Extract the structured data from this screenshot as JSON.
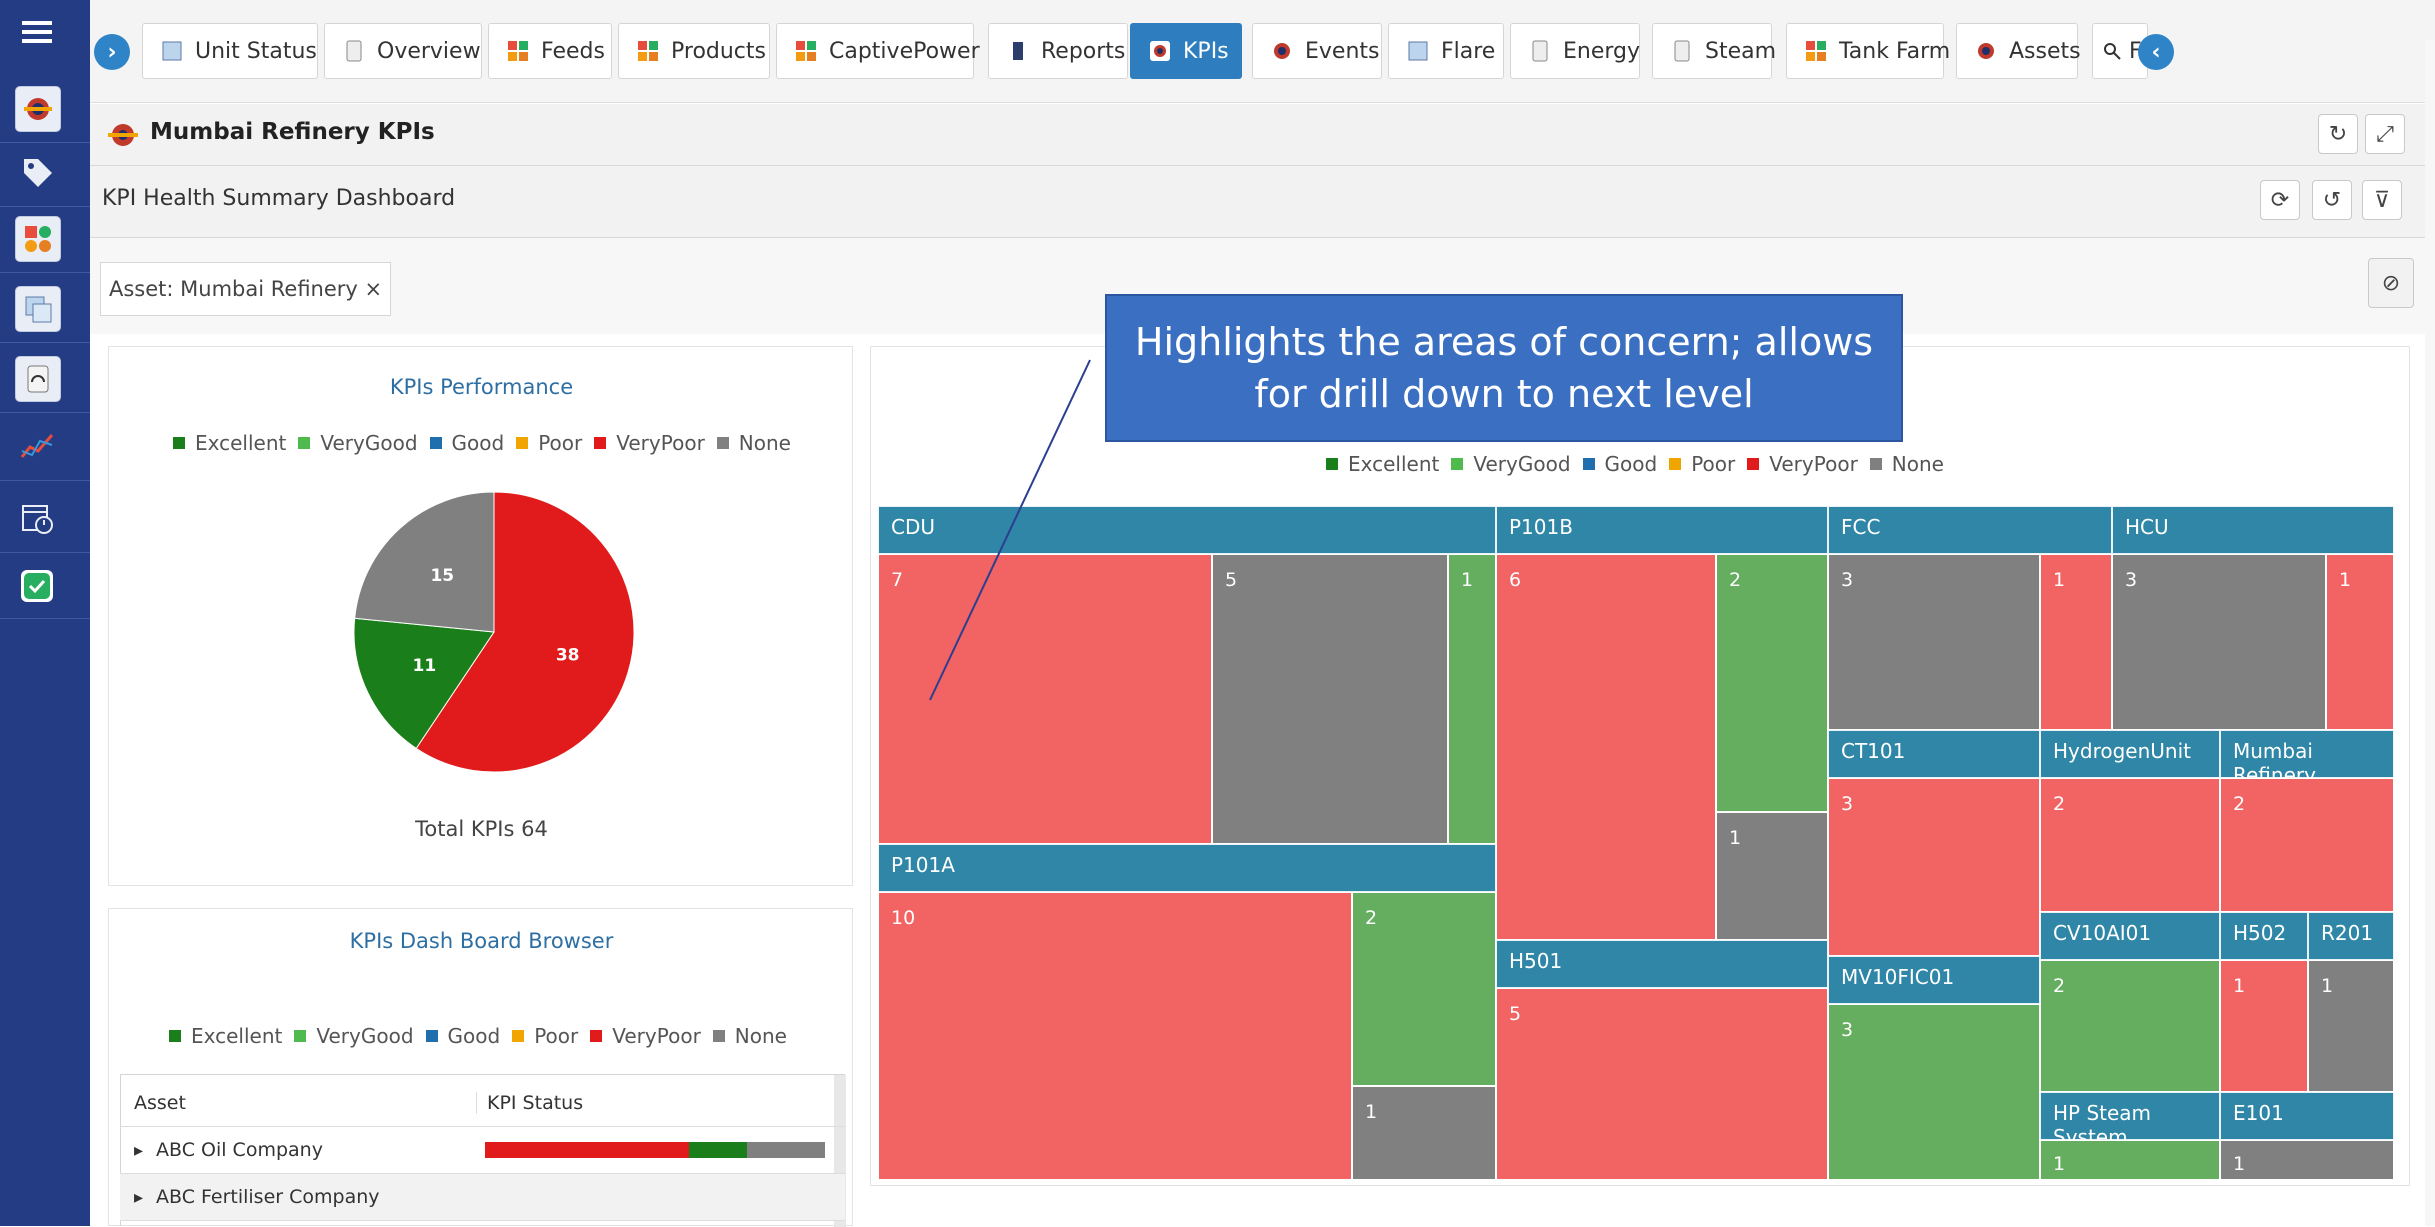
{
  "colors": {
    "rail": "#243c83",
    "accent": "#2e7ebf",
    "excellent": "#1a7f1a",
    "verygood": "#4fbb4f",
    "good": "#1f6fae",
    "poor": "#f0a500",
    "verypoor": "#e11b1b",
    "none": "#808080",
    "tm_red": "#f26363",
    "tm_green": "#65ad5f",
    "tm_gray": "#808080",
    "tm_band": "#2f86a6"
  },
  "rail_icons": [
    "menu-icon",
    "logo-icon",
    "tag-icon",
    "palette-icon",
    "monitor-icon",
    "gauge-icon",
    "trend-icon",
    "calendar-clock-icon",
    "check-icon"
  ],
  "tabs": [
    {
      "label": "Unit Status",
      "icon": "document-icon"
    },
    {
      "label": "Overview",
      "icon": "gauge-icon"
    },
    {
      "label": "Feeds",
      "icon": "grid-icon"
    },
    {
      "label": "Products",
      "icon": "grid-icon"
    },
    {
      "label": "CaptivePower",
      "icon": "grid-icon"
    },
    {
      "label": "Reports",
      "icon": "book-icon"
    },
    {
      "label": "KPIs",
      "icon": "target-icon",
      "active": true
    },
    {
      "label": "Events",
      "icon": "target-icon"
    },
    {
      "label": "Flare",
      "icon": "document-icon"
    },
    {
      "label": "Energy",
      "icon": "gauge-icon"
    },
    {
      "label": "Steam",
      "icon": "gauge-icon"
    },
    {
      "label": "Tank Farm",
      "icon": "grid-icon"
    },
    {
      "label": "Assets",
      "icon": "target-icon"
    },
    {
      "label": "F",
      "icon": "search-icon"
    }
  ],
  "title_bar": {
    "title": "Mumbai Refinery KPIs"
  },
  "dashboard_bar": {
    "title": "KPI Health Summary Dashboard"
  },
  "filter": {
    "chip": "Asset: Mumbai Refinery ×"
  },
  "callout": {
    "text": "Highlights the areas of concern; allows for drill down to next level"
  },
  "legend_labels": [
    "Excellent",
    "VeryGood",
    "Good",
    "Poor",
    "VeryPoor",
    "None"
  ],
  "pie": {
    "title": "KPIs Performance",
    "total_label": "Total KPIs 64",
    "slices": [
      {
        "label": "VeryPoor",
        "value": 38
      },
      {
        "label": "Excellent",
        "value": 11
      },
      {
        "label": "None",
        "value": 15
      }
    ]
  },
  "browser": {
    "title": "KPIs Dash Board Browser",
    "columns": [
      "Asset",
      "KPI Status"
    ],
    "rows": [
      {
        "asset": "ABC Oil Company",
        "status": {
          "verypoor": 0.6,
          "excellent": 0.17,
          "none": 0.23
        }
      },
      {
        "asset": "ABC Fertiliser Company",
        "status": null
      }
    ]
  },
  "treemap": {
    "groups": [
      {
        "name": "CDU",
        "cells": [
          "7",
          "5",
          "1"
        ]
      },
      {
        "name": "P101A",
        "cells": [
          "10",
          "2",
          "1"
        ]
      },
      {
        "name": "P101B",
        "cells": [
          "6",
          "2",
          "1"
        ]
      },
      {
        "name": "H501",
        "cells": [
          "5"
        ]
      },
      {
        "name": "FCC",
        "cells": [
          "3",
          "1"
        ]
      },
      {
        "name": "HCU",
        "cells": [
          "3",
          "1"
        ]
      },
      {
        "name": "CT101",
        "cells": [
          "3"
        ]
      },
      {
        "name": "HydrogenUnit",
        "cells": [
          "2"
        ]
      },
      {
        "name": "Mumbai Refinery",
        "cells": [
          "2"
        ]
      },
      {
        "name": "MV10FIC01",
        "cells": [
          "3"
        ]
      },
      {
        "name": "CV10AI01",
        "cells": [
          "2"
        ]
      },
      {
        "name": "H502",
        "cells": [
          "1"
        ]
      },
      {
        "name": "R201",
        "cells": [
          "1"
        ]
      },
      {
        "name": "HP Steam System",
        "cells": [
          "1"
        ]
      },
      {
        "name": "E101",
        "cells": [
          "1"
        ]
      }
    ]
  }
}
